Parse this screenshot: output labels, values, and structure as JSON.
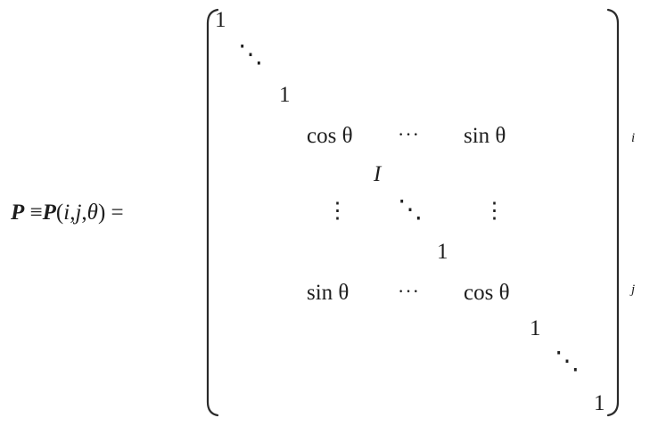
{
  "equation": {
    "lhs": {
      "p_symbol": "P",
      "equiv": "≡",
      "p_symbol2": "P",
      "args_open": "(",
      "arg_i": "i",
      "comma1": ",",
      "arg_j": "j",
      "comma2": ",",
      "arg_theta": "θ",
      "args_close": ")",
      "equals": "="
    },
    "matrix": {
      "one_top": "1",
      "ddots_1": "⋱",
      "one_2": "1",
      "cos_row_i": "cos θ",
      "cdots_row_i": "···",
      "sin_row_i": "sin θ",
      "identity": "I",
      "vdots_left": "⋮",
      "ddots_mid": "⋱",
      "vdots_right": "⋮",
      "one_mid": "1",
      "sin_row_j": "sin θ",
      "cdots_row_j": "···",
      "cos_row_j": "cos θ",
      "one_lower": "1",
      "ddots_2": "⋱",
      "one_bottom": "1"
    },
    "row_labels": {
      "i": "i",
      "j": "j"
    }
  }
}
